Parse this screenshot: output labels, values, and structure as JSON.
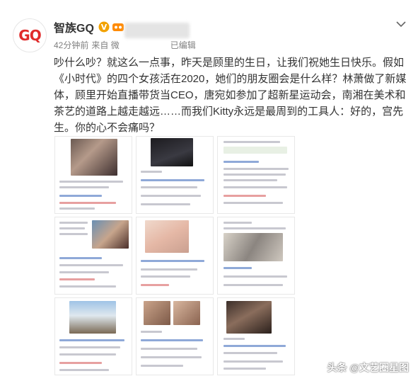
{
  "post": {
    "author": {
      "avatar_text": "GQ",
      "name": "智族GQ"
    },
    "meta": {
      "time": "42分钟前",
      "source_prefix": "来自 微",
      "edited": "已编辑"
    },
    "text": "吵什么吵？就这么一点事，昨天是顾里的生日，让我们祝她生日快乐。假如《小时代》的四个女孩活在2020，她们的朋友圈会是什么样？林萧做了新媒体，顾里开始直播带货当CEO，唐宛如参加了超新星运动会，南湘在美术和茶艺的道路上越走越远……而我们Kitty永远是最周到的工具人：好的，宫先生。你的心不会痛吗？"
  },
  "images": {
    "count": 9,
    "captions": {
      "top_left_header": "林萧、顾里、宛如、南湘",
      "middle_left_header": "真正上来了不知道"
    }
  },
  "watermark": "头条 @文艺圈星图",
  "colors": {
    "accent_red": "#e02b2b",
    "gold": "#f2a200",
    "muted": "#808080"
  }
}
